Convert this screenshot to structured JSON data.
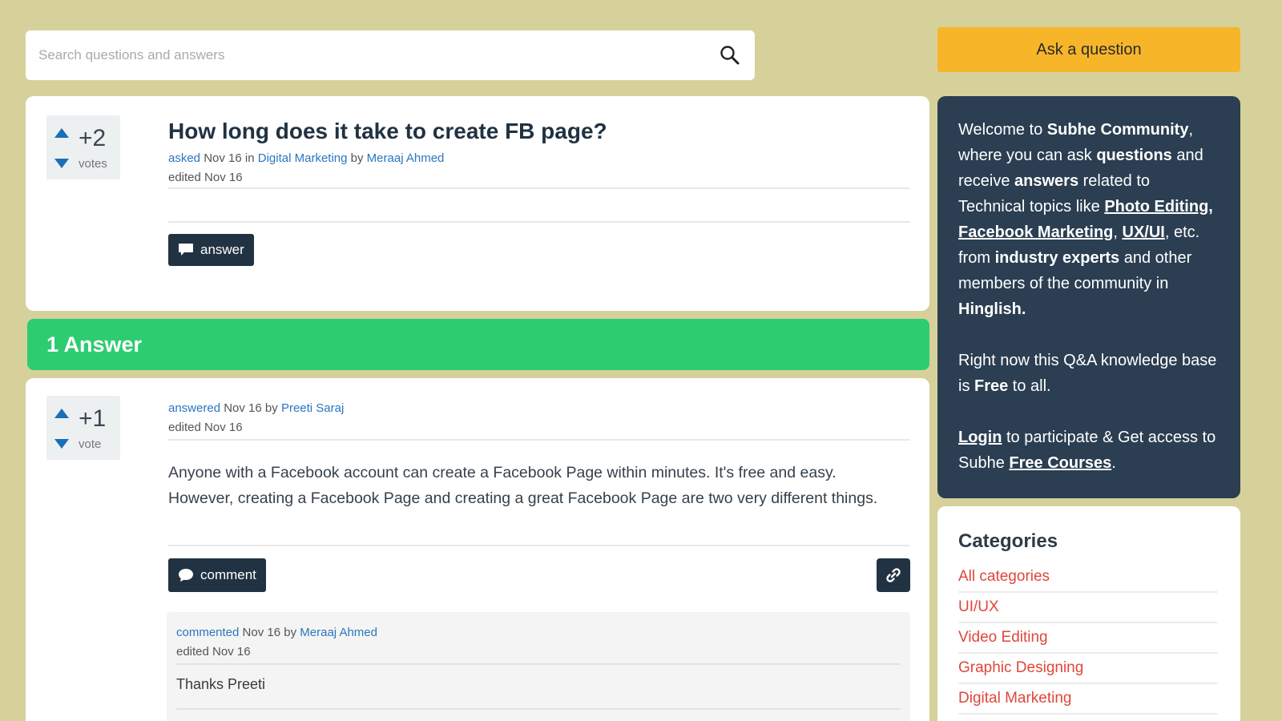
{
  "search": {
    "placeholder": "Search questions and answers"
  },
  "ask_button": "Ask a question",
  "question": {
    "votes": "+2",
    "votes_label": "votes",
    "title": "How long does it take to create FB page?",
    "asked_link": "asked",
    "asked_date": "Nov 16",
    "in_word": "in",
    "category": "Digital Marketing",
    "by_word": "by",
    "author": "Meraaj Ahmed",
    "edited": "edited Nov 16",
    "answer_button": "answer"
  },
  "answers_header": "1 Answer",
  "answer": {
    "votes": "+1",
    "votes_label": "vote",
    "answered_link": "answered",
    "answered_date": "Nov 16",
    "by_word": "by",
    "author": "Preeti Saraj",
    "edited": "edited Nov 16",
    "text": "Anyone with a Facebook account can create a Facebook Page within minutes. It's free and easy. However, creating a Facebook Page and creating a great Facebook Page are two very different things.",
    "comment_button": "comment"
  },
  "comment": {
    "commented_link": "commented",
    "commented_date": "Nov 16",
    "by_word": "by",
    "author": "Meraaj Ahmed",
    "edited": "edited Nov 16",
    "text": "Thanks Preeti"
  },
  "welcome": {
    "t1": "Welcome to ",
    "community": "Subhe Community",
    "t2": ", where you can ask ",
    "questions": "questions",
    "t3": " and receive ",
    "answers": "answers",
    "t4": " related to Technical topics like ",
    "topic1": "Photo Editing",
    "sep1": ", ",
    "topic2": "Facebook Marketing",
    "sep2": ", ",
    "topic3": "UX/UI",
    "t5": ", etc. from ",
    "experts": "industry experts",
    "t6": " and other members of the community in ",
    "hinglish": "Hinglish.",
    "p2a": "Right now this Q&A knowledge base is ",
    "free": "Free",
    "p2b": " to all.",
    "login": "Login",
    "p3a": " to participate & Get access to Subhe ",
    "courses": "Free Courses",
    "p3b": "."
  },
  "categories": {
    "title": "Categories",
    "items": [
      "All categories",
      "UI/UX",
      "Video Editing",
      "Graphic Designing",
      "Digital Marketing"
    ]
  },
  "colors": {
    "background": "#d6d19b",
    "ask_button": "#f7b52a",
    "answer_header": "#2ecc71",
    "sidebar_welcome": "#2b3e52",
    "dark_button": "#213242",
    "category_link": "#e0463a",
    "link": "#2a76c0"
  }
}
